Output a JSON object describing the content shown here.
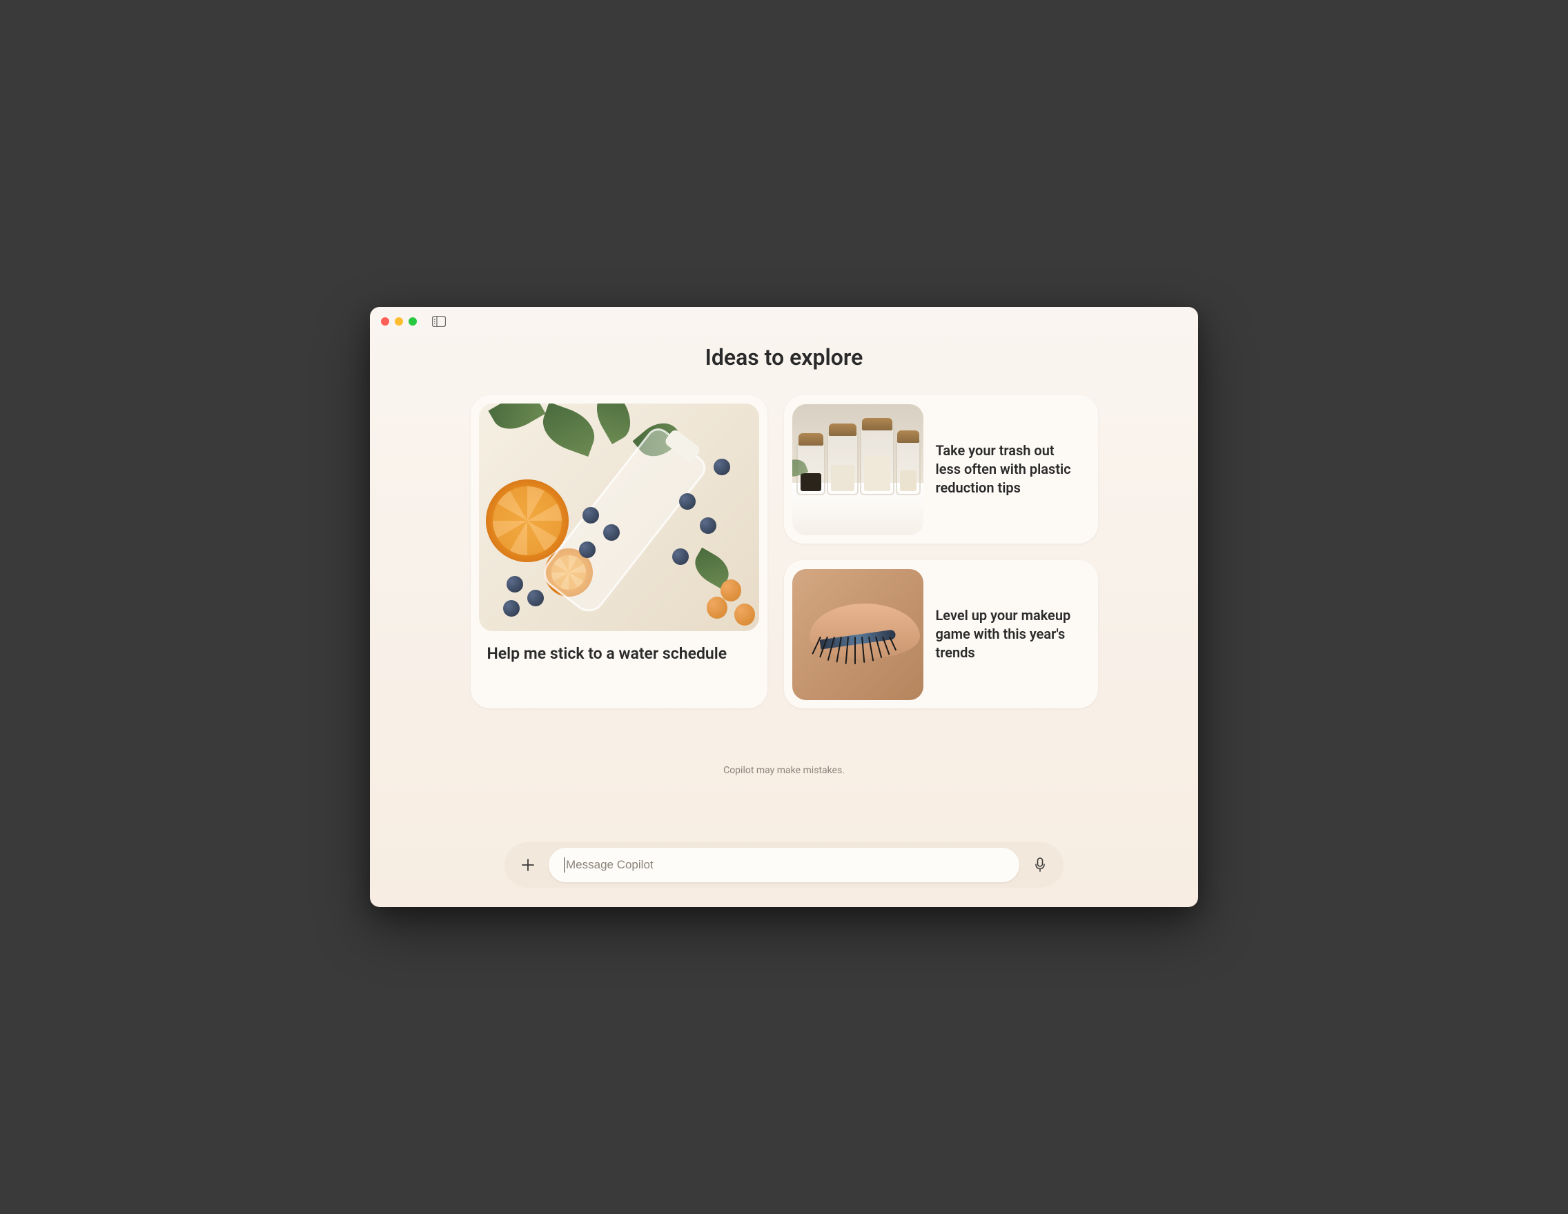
{
  "heading": "Ideas to explore",
  "cards": {
    "primary": {
      "text": "Help me stick to a water schedule"
    },
    "secondary": [
      {
        "text": "Take your trash out less often with plastic reduction tips"
      },
      {
        "text": "Level up your makeup game with this year's trends"
      }
    ]
  },
  "disclaimer": "Copilot may make mistakes.",
  "input": {
    "placeholder": "Message Copilot"
  }
}
